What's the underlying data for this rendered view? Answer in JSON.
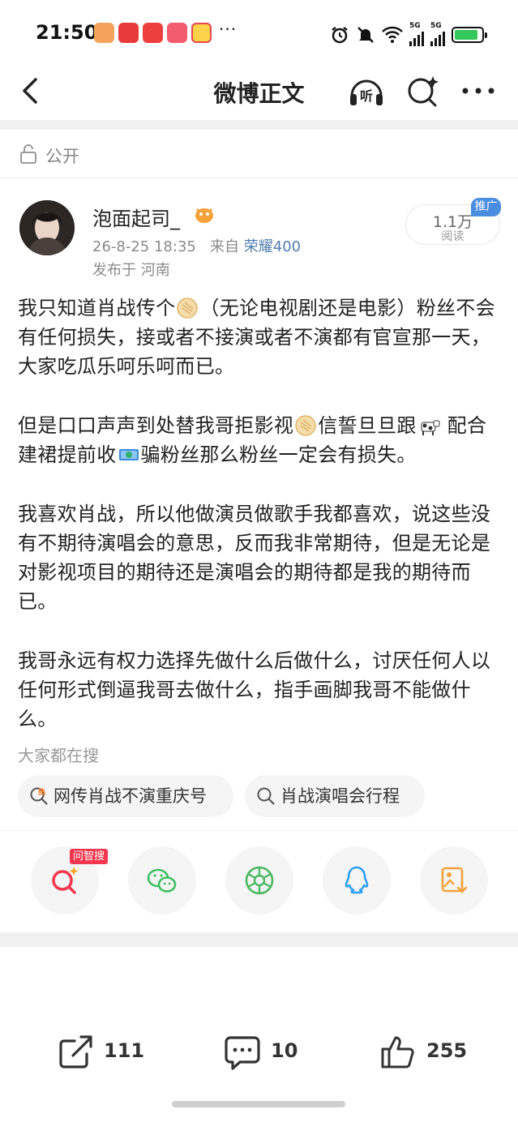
{
  "status_bar": {
    "time": "21:50",
    "more": "···",
    "network_1": "5G",
    "network_2": "5G"
  },
  "nav": {
    "title": "微博正文",
    "listen_label": "听"
  },
  "visibility": {
    "label": "公开"
  },
  "author": {
    "name": "泡面起司_",
    "date": "26-8-25 18:35",
    "from_label": "来自",
    "source": "荣耀400",
    "location": "发布于 河南",
    "reads_count": "1.1万",
    "reads_label": "阅读",
    "promo": "推广"
  },
  "post": {
    "p1a": "我只知道肖战传个",
    "p1b": "（无论电视剧还是电影）粉丝不会有任何损失，接或者不接演或者不演都有官宣那一天，大家吃瓜乐呵乐呵而已。",
    "p2a": "但是口口声声到处替我哥拒影视",
    "p2b": "信誓旦旦跟",
    "p2c": "配合建裙提前收",
    "p2d": "骗粉丝那么粉丝一定会有损失。",
    "p3": "我喜欢肖战，所以他做演员做歌手我都喜欢，说这些没有不期待演唱会的意思，反而我非常期待，但是无论是对影视项目的期待还是演唱会的期待都是我的期待而已。",
    "p4": "我哥永远有权力选择先做什么后做什么，讨厌任何人以任何形式倒逼我哥去做什么，指手画脚我哥不能做什么。"
  },
  "trending": {
    "label": "大家都在搜",
    "chips": [
      "网传肖战不演重庆号",
      "肖战演唱会行程"
    ],
    "hot_tag": "热"
  },
  "share": {
    "ask_badge": "问智搜"
  },
  "actions": {
    "reposts": "111",
    "comments": "10",
    "likes": "255"
  },
  "colors": {
    "link": "#507daf",
    "promo": "#4a8de0",
    "ask_badge": "#f2374e",
    "wechat": "#3fbf62",
    "moments": "#49b860",
    "qq": "#2e9ef4",
    "save": "#f2a23a"
  }
}
